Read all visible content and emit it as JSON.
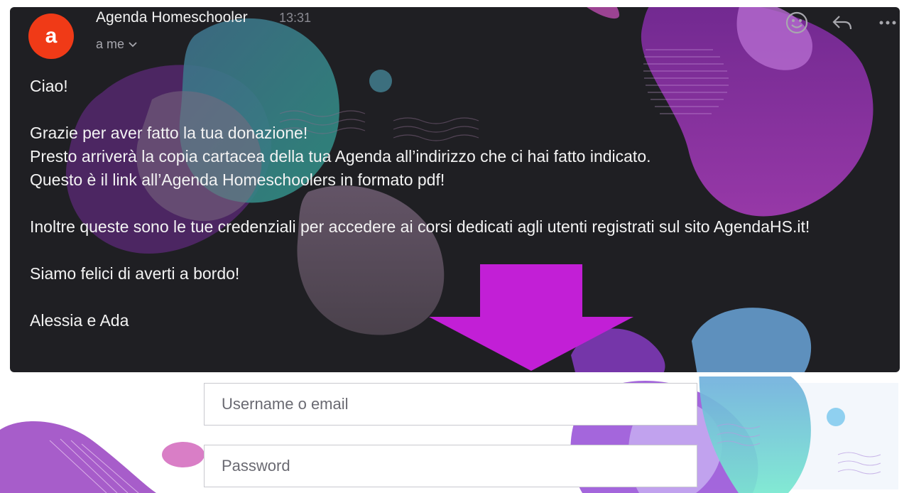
{
  "email": {
    "avatar_letter": "a",
    "sender": "Agenda Homeschooler",
    "time": "13:31",
    "recipient": "a me",
    "icons": {
      "emoji": "smiley-icon",
      "reply": "reply-icon",
      "more": "more-icon",
      "recipient_chevron": "chevron-down-icon"
    },
    "body": {
      "greeting": "Ciao!",
      "line1": "Grazie per aver fatto la tua donazione!",
      "line2": "Presto arriverà la copia cartacea della tua Agenda all’indirizzo che ci hai fatto indicato.",
      "line3": "Questo è il link all’Agenda Homeschoolers in formato pdf!",
      "line4": "Inoltre queste sono le tue credenziali per accedere ai corsi dedicati agli utenti registrati sul sito AgendaHS.it!",
      "line5": "Siamo felici di averti a bordo!",
      "signature": "Alessia e Ada"
    }
  },
  "login_form": {
    "username_placeholder": "Username o email",
    "password_placeholder": "Password"
  },
  "colors": {
    "card_background": "#1f1f23",
    "avatar": "#f03a17",
    "arrow": "#c21fd6"
  }
}
